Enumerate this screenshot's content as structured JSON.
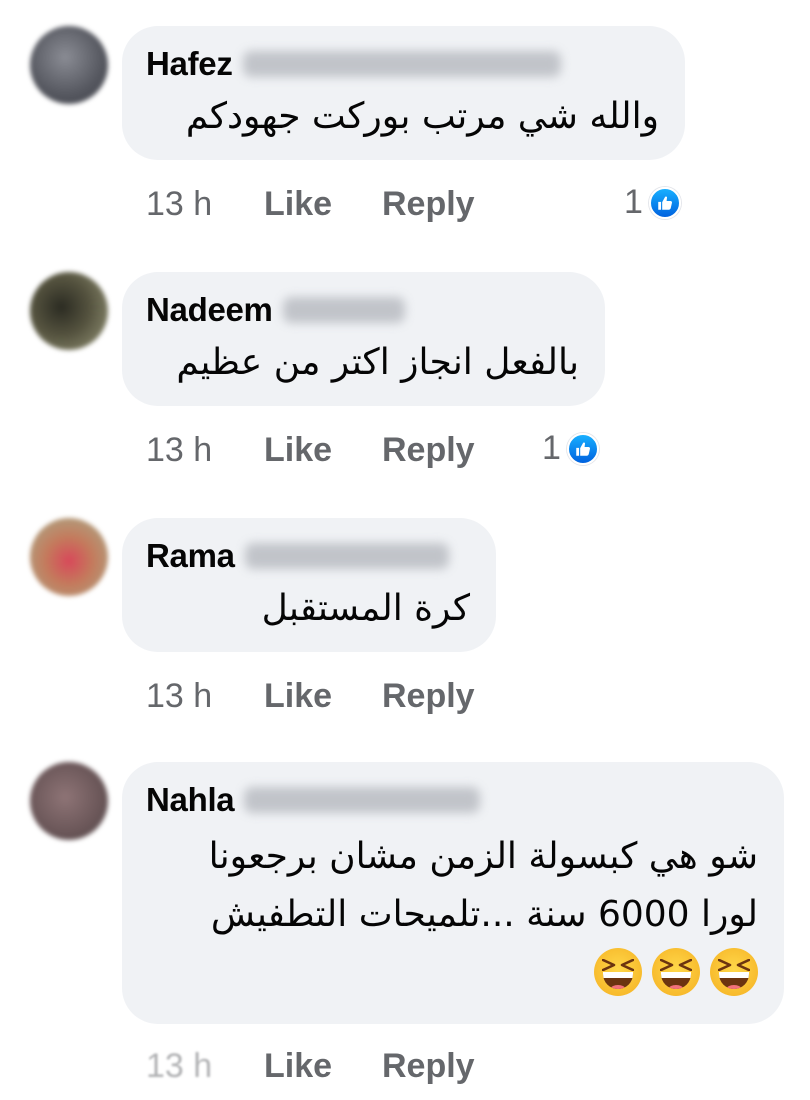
{
  "comments": [
    {
      "author": "Hafez",
      "lines": [
        "والله شي مرتب بوركت جهودكم"
      ],
      "time": "13 h",
      "like_label": "Like",
      "reply_label": "Reply",
      "reaction_count": "1",
      "avatar_color": "#5b5d66"
    },
    {
      "author": "Nadeem",
      "lines": [
        "بالفعل انجاز اكتر من عظيم"
      ],
      "time": "13 h",
      "like_label": "Like",
      "reply_label": "Reply",
      "reaction_count": "1",
      "avatar_color": "#3d3f38"
    },
    {
      "author": "Rama",
      "lines": [
        "كرة المستقبل"
      ],
      "time": "13 h",
      "like_label": "Like",
      "reply_label": "Reply",
      "avatar_color": "#c06a5a"
    },
    {
      "author": "Nahla",
      "lines": [
        "شو هي كبسولة الزمن مشان برجعونا",
        "لورا 6000 سنة ...تلميحات التطفيش"
      ],
      "emoji_count": 3,
      "time": "13 h",
      "like_label": "Like",
      "reply_label": "Reply",
      "avatar_color": "#7a6466"
    }
  ],
  "icons": {
    "reaction": "like-thumbs-up-icon",
    "emoji": "grinning-squinting-face-icon"
  },
  "colors": {
    "bubble_bg": "#f0f2f5",
    "secondary_text": "#65676b",
    "like_blue": "#0866ff"
  }
}
